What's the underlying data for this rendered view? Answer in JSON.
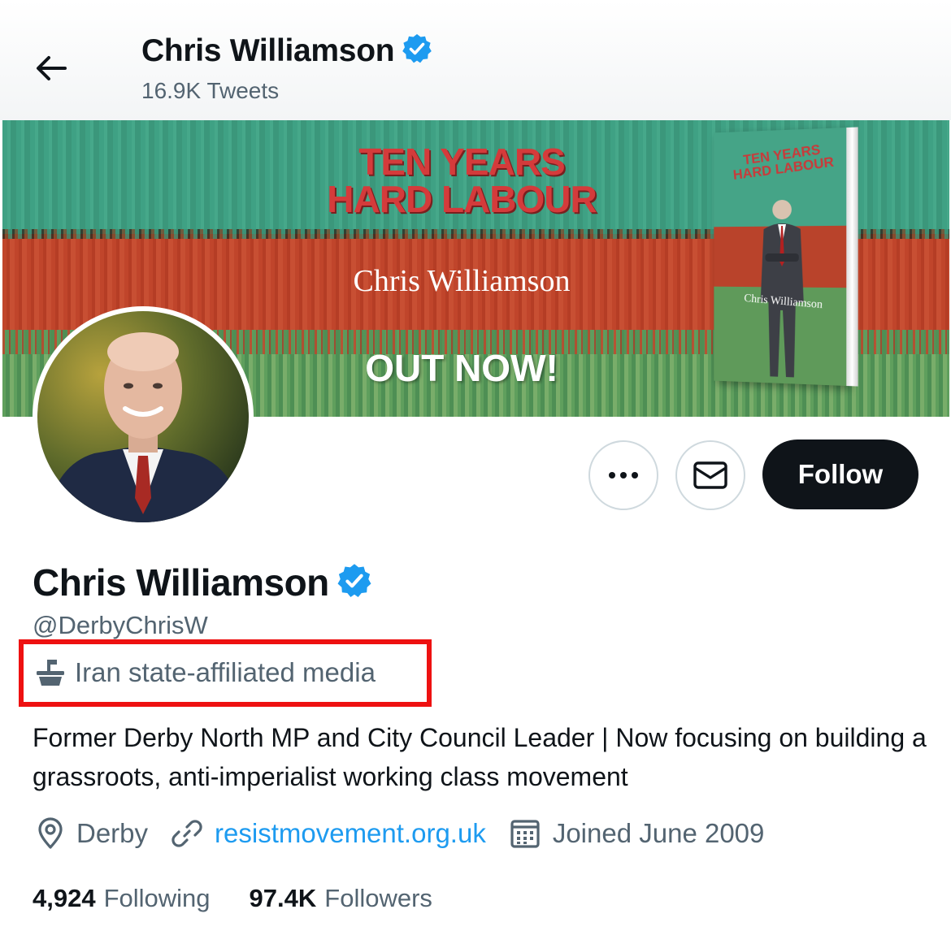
{
  "header": {
    "back_icon": "arrow-left-icon",
    "name": "Chris Williamson",
    "tweet_count": "16.9K Tweets",
    "verified_icon": "verified-badge-icon"
  },
  "banner": {
    "title_line1": "TEN YEARS",
    "title_line2": "HARD LABOUR",
    "author": "Chris Williamson",
    "cta": "OUT NOW!",
    "book_title": "TEN YEARS HARD LABOUR",
    "book_author": "Chris Williamson"
  },
  "actions": {
    "more_icon": "more-horizontal-icon",
    "message_icon": "envelope-icon",
    "follow_label": "Follow"
  },
  "profile": {
    "name": "Chris Williamson",
    "handle": "@DerbyChrisW",
    "label_icon": "government-building-icon",
    "label_text": "Iran state-affiliated media",
    "bio": "Former Derby North MP and City Council Leader | Now focusing on building a grassroots, anti-imperialist working class movement",
    "location": "Derby",
    "website": "resistmovement.org.uk",
    "joined": "Joined June 2009"
  },
  "stats": {
    "following_count": "4,924",
    "following_label": "Following",
    "followers_count": "97.4K",
    "followers_label": "Followers"
  },
  "colors": {
    "accent_blue": "#1d9bf0",
    "highlight_red": "#ee1111",
    "text_primary": "#0f1419",
    "text_secondary": "#536471"
  }
}
